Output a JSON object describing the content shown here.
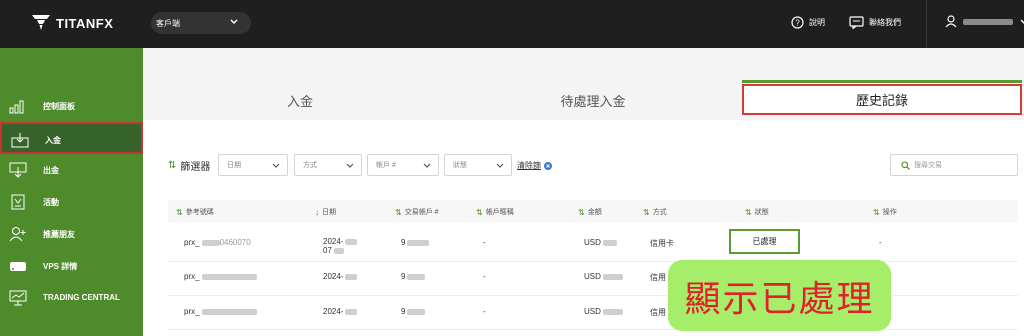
{
  "brand": {
    "name": "TITANFX"
  },
  "topbar": {
    "client_select": "客戶端",
    "help_label": "說明",
    "contact_label": "聯絡我們"
  },
  "sidebar": {
    "items": [
      {
        "label": "控制面板",
        "icon": "chart-bars-icon"
      },
      {
        "label": "入金",
        "icon": "deposit-icon",
        "active": true
      },
      {
        "label": "出金",
        "icon": "withdraw-icon"
      },
      {
        "label": "活動",
        "icon": "promotion-icon"
      },
      {
        "label": "推薦朋友",
        "icon": "refer-friend-icon"
      },
      {
        "label": "VPS 詳情",
        "icon": "vps-icon"
      },
      {
        "label": "TRADING CENTRAL",
        "icon": "trading-central-icon"
      }
    ]
  },
  "tabs": [
    {
      "label": "入金"
    },
    {
      "label": "待處理入金"
    },
    {
      "label": "歷史記錄",
      "active": true
    }
  ],
  "filters": {
    "label": "篩選器",
    "date": "日期",
    "method": "方式",
    "account": "帳戶 #",
    "status": "狀態",
    "clear": "清除篩",
    "search_placeholder": "搜尋交易"
  },
  "table": {
    "columns": [
      "參考號碼",
      "日期",
      "交易帳戶 #",
      "帳戶暱稱",
      "金額",
      "方式",
      "狀態",
      "操作"
    ],
    "rows": [
      {
        "ref": "prx_",
        "ref_tail": "0460070",
        "date": "2024-",
        "date2": "07",
        "account": "9",
        "nickname": "-",
        "amount": "USD",
        "method": "信用卡",
        "status": "已處理",
        "action": "-"
      },
      {
        "ref": "prx_",
        "ref_tail": "",
        "date": "2024-",
        "date2": "",
        "account": "9",
        "nickname": "-",
        "amount": "USD",
        "method": "信用",
        "status": "",
        "action": ""
      },
      {
        "ref": "prx_",
        "ref_tail": "",
        "date": "2024-",
        "date2": "",
        "account": "9",
        "nickname": "-",
        "amount": "USD",
        "method": "信用",
        "status": "",
        "action": ""
      }
    ]
  },
  "callout": {
    "text": "顯示已處理"
  },
  "colors": {
    "sidebar": "#4e8b2a",
    "accent": "#5a9b32",
    "highlight": "#d43a3a",
    "callout_bg": "#a6ee6a",
    "callout_text": "#e0202a"
  }
}
